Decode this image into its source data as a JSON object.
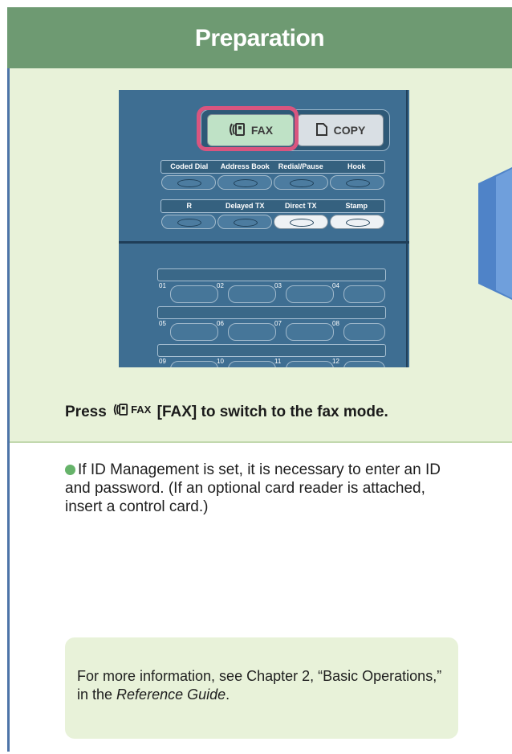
{
  "header": {
    "title": "Preparation"
  },
  "panel": {
    "mode_fax": "FAX",
    "mode_copy": "COPY",
    "row1": [
      "Coded Dial",
      "Address Book",
      "Redial/Pause",
      "Hook"
    ],
    "row2": [
      "R",
      "Delayed TX",
      "Direct TX",
      "Stamp"
    ],
    "onetouch": [
      [
        "01",
        "02",
        "03",
        "04"
      ],
      [
        "05",
        "06",
        "07",
        "08"
      ],
      [
        "09",
        "10",
        "11",
        "12"
      ]
    ]
  },
  "caption": {
    "press": "Press",
    "fax_label": "FAX",
    "action": "[FAX] to switch to the fax mode."
  },
  "note": {
    "text": "If ID Management is set, it is necessary to enter an ID and password. (If an optional card reader is attached, insert a control card.)"
  },
  "info": {
    "prefix": "For more information, see Chapter 2, “Basic Operations,” in the ",
    "guide": "Reference Guide",
    "suffix": "."
  },
  "colors": {
    "header": "#6e9a72",
    "highlight": "#d9557f",
    "panel": "#3e6e92",
    "bullet": "#66b36a",
    "arrow": "#5b8fcf"
  },
  "icons": [
    "fax-icon",
    "copy-icon",
    "next-arrow-icon",
    "bullet-icon"
  ]
}
